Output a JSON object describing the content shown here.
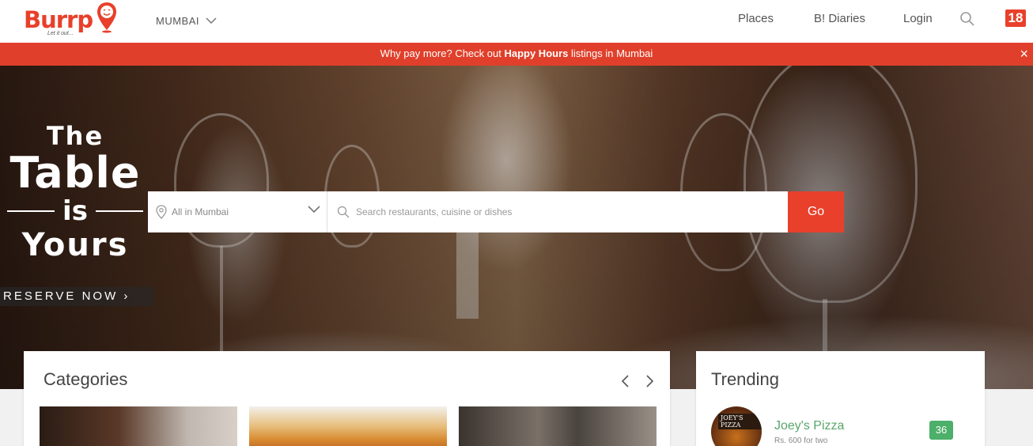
{
  "brand": {
    "name": "Burrp",
    "tagline": "Let it out...",
    "color": "#e8402b"
  },
  "header": {
    "city": "MUMBAI",
    "nav": [
      "Places",
      "B! Diaries",
      "Login"
    ],
    "partner_badge": "18"
  },
  "promo": {
    "prefix": "Why pay more? Check out ",
    "highlight": "Happy Hours",
    "suffix": " listings in Mumbai",
    "close": "×"
  },
  "hero": {
    "line1": "The",
    "line2": "Table",
    "line3": "is",
    "line4": "Yours",
    "cta": "RESERVE NOW ›"
  },
  "search": {
    "location": "All in Mumbai",
    "placeholder": "Search restaurants, cuisine or dishes",
    "button": "Go"
  },
  "categories": {
    "title": "Categories"
  },
  "trending": {
    "title": "Trending",
    "items": [
      {
        "name": "Joey's Pizza",
        "price": "Rs. 600 for two",
        "score": "36",
        "sign": "JOEY'S PIZZA"
      }
    ]
  }
}
